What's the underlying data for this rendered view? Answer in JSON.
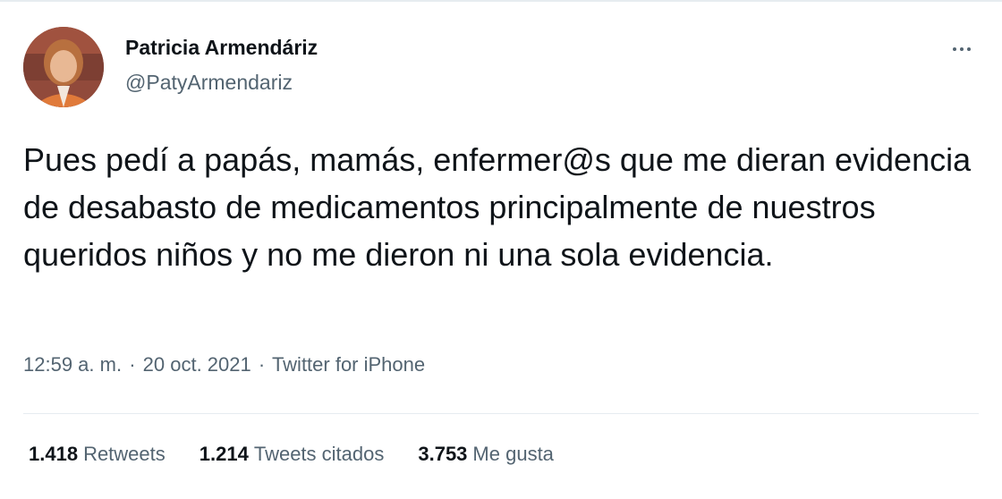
{
  "author": {
    "display_name": "Patricia Armendáriz",
    "handle": "@PatyArmendariz"
  },
  "tweet": {
    "text": "Pues pedí a papás, mamás, enfermer@s que me dieran evidencia de desabasto de medicamentos principalmente de nuestros queridos niños y no me dieron ni una sola evidencia."
  },
  "meta": {
    "time": "12:59 a. m.",
    "separator": "·",
    "date": "20 oct. 2021",
    "source": "Twitter for iPhone"
  },
  "stats": {
    "retweets_count": "1.418",
    "retweets_label": "Retweets",
    "quotes_count": "1.214",
    "quotes_label": "Tweets citados",
    "likes_count": "3.753",
    "likes_label": "Me gusta"
  },
  "icons": {
    "more": "more-horizontal-icon",
    "avatar": "profile-photo"
  },
  "colors": {
    "text_primary": "#0f1419",
    "text_secondary": "#536471",
    "divider": "#e6ecf0"
  }
}
